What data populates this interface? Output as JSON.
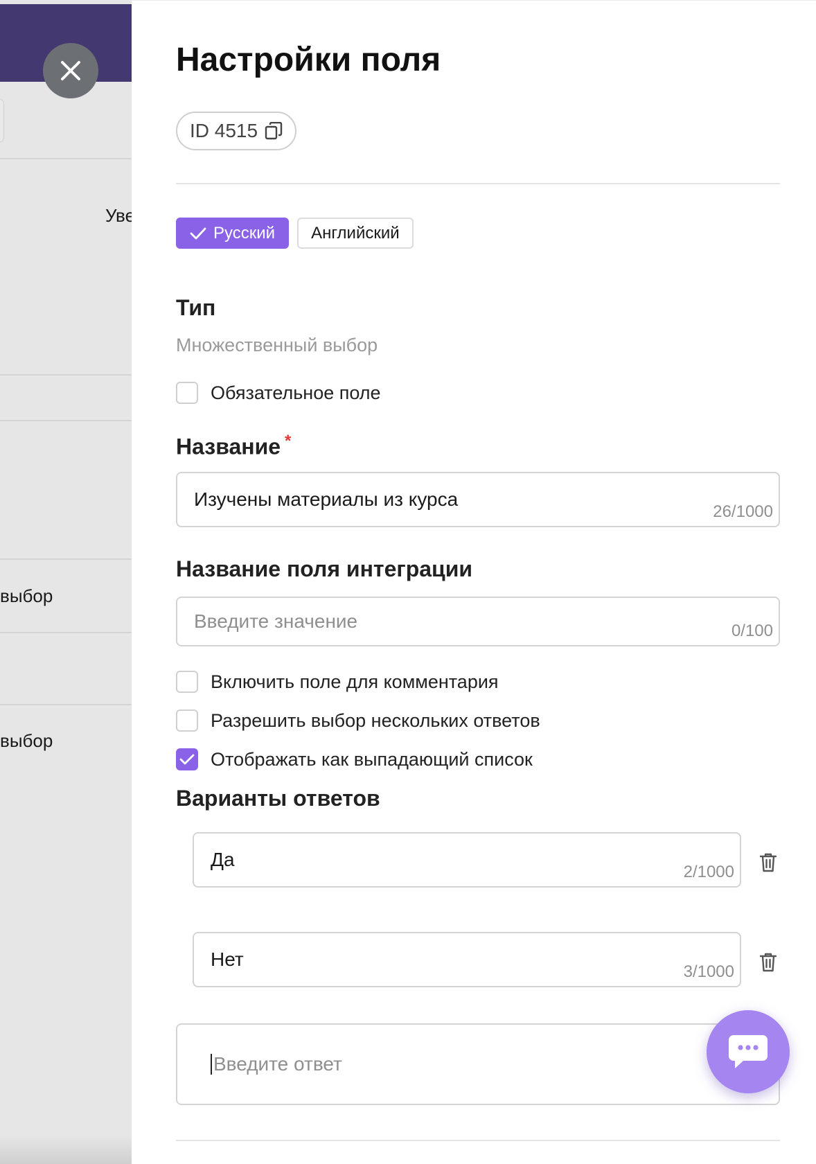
{
  "backdrop": {
    "partial_label_1": "Уве",
    "partial_label_2": "выбор",
    "partial_label_3": "выбор"
  },
  "panel": {
    "title": "Настройки поля",
    "id_chip": "ID 4515",
    "languages": [
      "Русский",
      "Английский"
    ],
    "type_label": "Тип",
    "type_value": "Множественный выбор",
    "required_checkbox": "Обязательное поле",
    "name_label": "Название",
    "name_value": "Изучены материалы из курса",
    "name_counter": "26/1000",
    "integration_label": "Название поля интеграции",
    "integration_placeholder": "Введите значение",
    "integration_counter": "0/100",
    "options": [
      {
        "label": "Включить поле для комментария",
        "checked": false
      },
      {
        "label": "Разрешить выбор нескольких ответов",
        "checked": false
      },
      {
        "label": "Отображать как выпадающий список",
        "checked": true
      }
    ],
    "answers_label": "Варианты ответов",
    "answers": [
      {
        "value": "Да",
        "counter": "2/1000"
      },
      {
        "value": "Нет",
        "counter": "3/1000"
      }
    ],
    "new_answer_placeholder": "Введите ответ"
  },
  "icons": {
    "close": "close-icon",
    "copy": "copy-icon",
    "check": "check-icon",
    "trash": "trash-icon",
    "chat": "chat-icon"
  },
  "colors": {
    "accent": "#8a62e8",
    "header_purple": "#443870",
    "chat_button": "#a585ef",
    "required_star": "#e53935"
  }
}
